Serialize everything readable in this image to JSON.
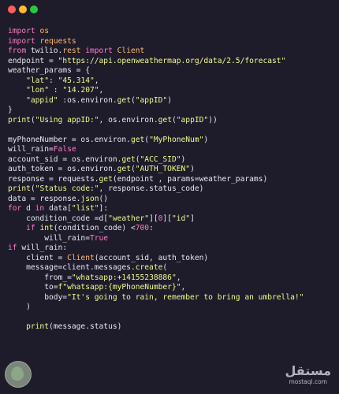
{
  "window": {
    "controls": [
      "close",
      "minimize",
      "maximize"
    ]
  },
  "code_lines": [
    [
      [
        "kw",
        "import"
      ],
      [
        "op",
        " "
      ],
      [
        "mod",
        "os"
      ]
    ],
    [
      [
        "kw",
        "import"
      ],
      [
        "op",
        " "
      ],
      [
        "mod",
        "requests"
      ]
    ],
    [
      [
        "kw",
        "from"
      ],
      [
        "op",
        " twilio."
      ],
      [
        "mod",
        "rest"
      ],
      [
        "op",
        " "
      ],
      [
        "kw",
        "import"
      ],
      [
        "op",
        " "
      ],
      [
        "cls",
        "Client"
      ]
    ],
    [
      [
        "var",
        "endpoint"
      ],
      [
        "op",
        " = "
      ],
      [
        "str",
        "\"https://api.openweathermap.org/data/2.5/forecast\""
      ]
    ],
    [
      [
        "var",
        "weather_params"
      ],
      [
        "op",
        " = {"
      ]
    ],
    [
      [
        "op",
        "    "
      ],
      [
        "str",
        "\"lat\""
      ],
      [
        "op",
        ": "
      ],
      [
        "str",
        "\"45.314\""
      ],
      [
        "op",
        ","
      ]
    ],
    [
      [
        "op",
        "    "
      ],
      [
        "str",
        "\"lon\""
      ],
      [
        "op",
        " : "
      ],
      [
        "str",
        "\"14.207\""
      ],
      [
        "op",
        ","
      ]
    ],
    [
      [
        "op",
        "    "
      ],
      [
        "str",
        "\"appid\""
      ],
      [
        "op",
        " :os.environ."
      ],
      [
        "fn",
        "get"
      ],
      [
        "op",
        "("
      ],
      [
        "str",
        "\"appID\""
      ],
      [
        "op",
        ")"
      ]
    ],
    [
      [
        "op",
        "}"
      ]
    ],
    [
      [
        "fn",
        "print"
      ],
      [
        "op",
        "("
      ],
      [
        "str",
        "\"Using appID:\""
      ],
      [
        "op",
        ", os.environ."
      ],
      [
        "fn",
        "get"
      ],
      [
        "op",
        "("
      ],
      [
        "str",
        "\"appID\""
      ],
      [
        "op",
        "))"
      ]
    ],
    [],
    [
      [
        "var",
        "myPhoneNumber"
      ],
      [
        "op",
        " = os.environ."
      ],
      [
        "fn",
        "get"
      ],
      [
        "op",
        "("
      ],
      [
        "str",
        "\"MyPhoneNum\""
      ],
      [
        "op",
        ")"
      ]
    ],
    [
      [
        "var",
        "will_rain"
      ],
      [
        "op",
        "="
      ],
      [
        "bool",
        "False"
      ]
    ],
    [
      [
        "var",
        "account_sid"
      ],
      [
        "op",
        " = os.environ."
      ],
      [
        "fn",
        "get"
      ],
      [
        "op",
        "("
      ],
      [
        "str",
        "\"ACC_SID\""
      ],
      [
        "op",
        ")"
      ]
    ],
    [
      [
        "var",
        "auth_token"
      ],
      [
        "op",
        " = os.environ."
      ],
      [
        "fn",
        "get"
      ],
      [
        "op",
        "("
      ],
      [
        "str",
        "\"AUTH_TOKEN\""
      ],
      [
        "op",
        ")"
      ]
    ],
    [
      [
        "var",
        "response"
      ],
      [
        "op",
        " = requests."
      ],
      [
        "fn",
        "get"
      ],
      [
        "op",
        "(endpoint , params=weather_params)"
      ]
    ],
    [
      [
        "fn",
        "print"
      ],
      [
        "op",
        "("
      ],
      [
        "str",
        "\"Status code:\""
      ],
      [
        "op",
        ", response.status_code)"
      ]
    ],
    [
      [
        "var",
        "data"
      ],
      [
        "op",
        " = response."
      ],
      [
        "fn",
        "json"
      ],
      [
        "op",
        "()"
      ]
    ],
    [
      [
        "kw",
        "for"
      ],
      [
        "op",
        " d "
      ],
      [
        "kw",
        "in"
      ],
      [
        "op",
        " data["
      ],
      [
        "str",
        "\"list\""
      ],
      [
        "op",
        "]:"
      ]
    ],
    [
      [
        "op",
        "    condition_code =d["
      ],
      [
        "str",
        "\"weather\""
      ],
      [
        "op",
        "]["
      ],
      [
        "num",
        "0"
      ],
      [
        "op",
        "]["
      ],
      [
        "str",
        "\"id\""
      ],
      [
        "op",
        "]"
      ]
    ],
    [
      [
        "op",
        "    "
      ],
      [
        "kw",
        "if"
      ],
      [
        "op",
        " "
      ],
      [
        "fn",
        "int"
      ],
      [
        "op",
        "(condition_code) <"
      ],
      [
        "num",
        "700"
      ],
      [
        "op",
        ":"
      ]
    ],
    [
      [
        "op",
        "        will_rain="
      ],
      [
        "bool",
        "True"
      ]
    ],
    [
      [
        "kw",
        "if"
      ],
      [
        "op",
        " will_rain:"
      ]
    ],
    [
      [
        "op",
        "    client = "
      ],
      [
        "cls",
        "Client"
      ],
      [
        "op",
        "(account_sid, auth_token)"
      ]
    ],
    [
      [
        "op",
        "    message=client.messages."
      ],
      [
        "fn",
        "create"
      ],
      [
        "op",
        "("
      ]
    ],
    [
      [
        "op",
        "        from_="
      ],
      [
        "str",
        "\"whatsapp:+14155238886\""
      ],
      [
        "op",
        ","
      ]
    ],
    [
      [
        "op",
        "        to="
      ],
      [
        "str",
        "f\"whatsapp:{myPhoneNumber}\""
      ],
      [
        "op",
        ","
      ]
    ],
    [
      [
        "op",
        "        body="
      ],
      [
        "str",
        "\"It's going to rain, remember to bring an umbrella!\""
      ]
    ],
    [
      [
        "op",
        "    )"
      ]
    ],
    [],
    [
      [
        "op",
        "    "
      ],
      [
        "fn",
        "print"
      ],
      [
        "op",
        "(message.status)"
      ]
    ]
  ],
  "watermark": {
    "brand_arabic": "مستقل",
    "site": "mostaql.com"
  },
  "colors": {
    "background": "#1e1c2b",
    "keyword": "#ff79c6",
    "module": "#ffb86c",
    "string": "#f1fa8c",
    "text": "#e6e6ef"
  }
}
